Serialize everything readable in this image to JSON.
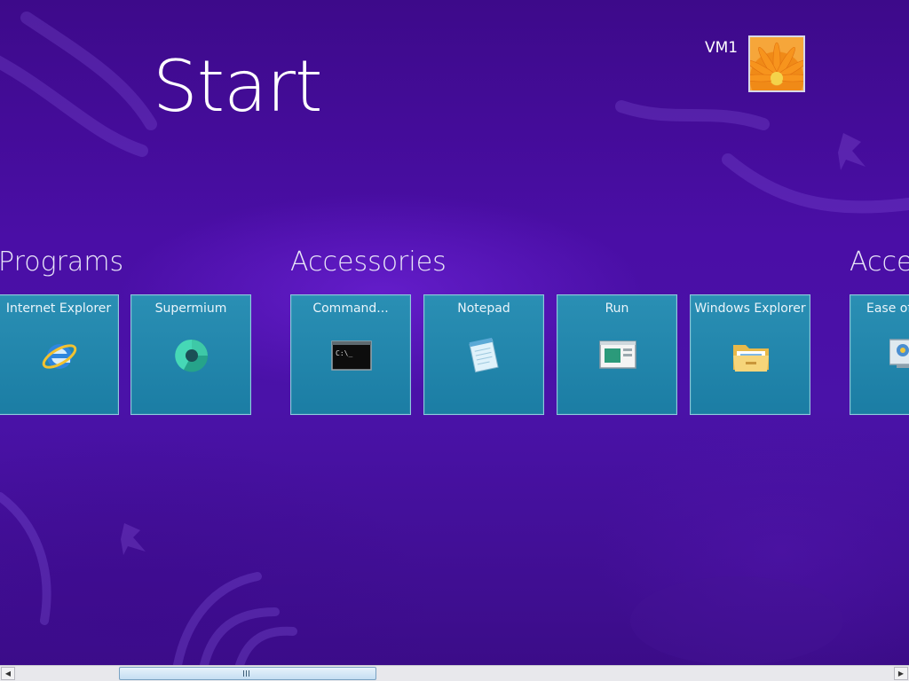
{
  "start": {
    "title": "Start",
    "user": {
      "name": "VM1"
    }
  },
  "groups": [
    {
      "header": "Programs",
      "tiles": [
        {
          "label": "Internet Explorer",
          "icon": "internet-explorer-icon"
        },
        {
          "label": "Supermium",
          "icon": "supermium-icon"
        }
      ]
    },
    {
      "header": "Accessories",
      "tiles": [
        {
          "label": "Command...",
          "icon": "command-prompt-icon"
        },
        {
          "label": "Notepad",
          "icon": "notepad-icon"
        },
        {
          "label": "Run",
          "icon": "run-icon"
        },
        {
          "label": "Windows Explorer",
          "icon": "folder-icon"
        }
      ]
    },
    {
      "header": "Acce",
      "tiles": [
        {
          "label": "Ease of",
          "icon": "ease-of-access-icon"
        }
      ]
    }
  ],
  "scrollbar": {
    "left_arrow": "◀",
    "right_arrow": "▶"
  },
  "colors": {
    "background": "#4a0ea6",
    "tile": "#1f84aa",
    "tile_border": "#8fc7dc",
    "text": "#ffffff"
  }
}
